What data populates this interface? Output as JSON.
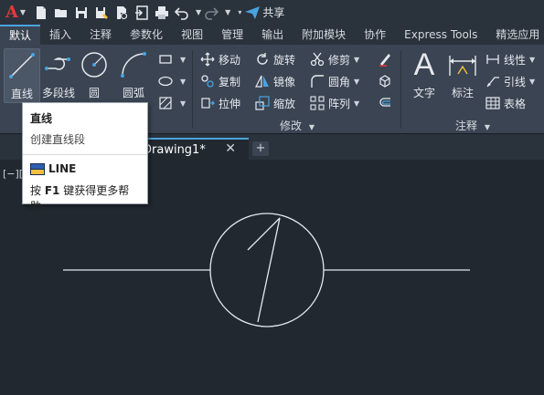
{
  "app": {
    "logo": "A"
  },
  "qat": {
    "share_label": "共享"
  },
  "ribbon_tabs": [
    "默认",
    "插入",
    "注释",
    "参数化",
    "视图",
    "管理",
    "输出",
    "附加模块",
    "协作",
    "Express Tools",
    "精选应用"
  ],
  "draw_panel": {
    "line": "直线",
    "polyline": "多段线",
    "circle": "圆",
    "arc": "圆弧"
  },
  "modify_panel": {
    "title": "修改",
    "move": "移动",
    "rotate": "旋转",
    "trim": "修剪",
    "copy": "复制",
    "mirror": "镜像",
    "fillet": "圆角",
    "stretch": "拉伸",
    "scale": "缩放",
    "array": "阵列"
  },
  "annotation_panel": {
    "title": "注释",
    "text": "文字",
    "dimension": "标注",
    "linear": "线性",
    "leader": "引线",
    "table": "表格"
  },
  "doc_tab": {
    "name": "Drawing1*",
    "close": "✕",
    "new": "+"
  },
  "viewport_label": "[−][",
  "tooltip": {
    "title": "直线",
    "description": "创建直线段",
    "command": "LINE",
    "help_prefix": "按 ",
    "help_key": "F1",
    "help_suffix": " 键获得更多帮助"
  },
  "colors": {
    "accent": "#4aa3df",
    "logo_red": "#e8383a",
    "canvas": "#212830",
    "ribbon": "#3a4452"
  }
}
